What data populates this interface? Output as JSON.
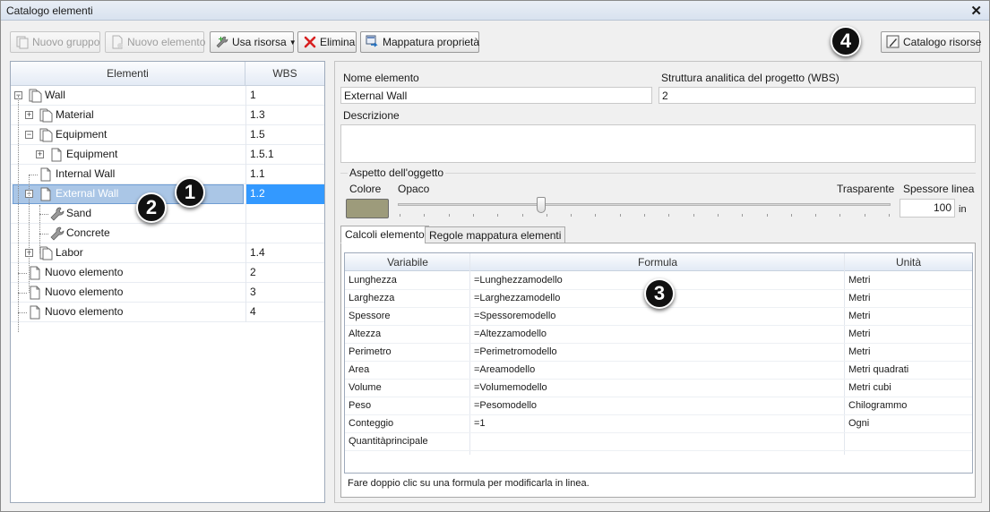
{
  "window": {
    "title": "Catalogo elementi"
  },
  "toolbar": {
    "new_group": "Nuovo gruppo",
    "new_element": "Nuovo elemento",
    "use_resource": "Usa risorsa",
    "delete": "Elimina",
    "property_mapping": "Mappatura proprietà",
    "resource_catalog": "Catalogo risorse"
  },
  "callouts": [
    "1",
    "2",
    "3",
    "4"
  ],
  "tree": {
    "col_elements": "Elementi",
    "col_wbs": "WBS",
    "rows": [
      {
        "name": "Wall",
        "wbs": "1"
      },
      {
        "name": "Material",
        "wbs": "1.3"
      },
      {
        "name": "Equipment",
        "wbs": "1.5"
      },
      {
        "name": "Equipment",
        "wbs": "1.5.1"
      },
      {
        "name": "Internal Wall",
        "wbs": "1.1"
      },
      {
        "name": "External Wall",
        "wbs": "1.2"
      },
      {
        "name": "Sand",
        "wbs": ""
      },
      {
        "name": "Concrete",
        "wbs": ""
      },
      {
        "name": "Labor",
        "wbs": "1.4"
      },
      {
        "name": "Nuovo elemento",
        "wbs": "2"
      },
      {
        "name": "Nuovo elemento",
        "wbs": "3"
      },
      {
        "name": "Nuovo elemento",
        "wbs": "4"
      }
    ]
  },
  "details": {
    "name_label": "Nome elemento",
    "name_value": "External Wall",
    "wbs_label": "Struttura analitica del progetto (WBS)",
    "wbs_value": "2",
    "description_label": "Descrizione",
    "description_value": "",
    "appearance": {
      "group_label": "Aspetto dell'oggetto",
      "color_label": "Colore",
      "opaque_label": "Opaco",
      "transparent_label": "Trasparente",
      "line_thickness_label": "Spessore linea",
      "line_thickness_value": "100",
      "line_thickness_unit": "in",
      "transparency_fraction": 0.29,
      "color": "#9d9b7b"
    },
    "tabs": [
      "Calcoli elemento",
      "Regole mappatura elementi"
    ],
    "grid": {
      "headers": [
        "Variabile",
        "Formula",
        "Unità"
      ],
      "rows": [
        {
          "variable": "Lunghezza",
          "formula": "=Lunghezzamodello",
          "unit": "Metri"
        },
        {
          "variable": "Larghezza",
          "formula": "=Larghezzamodello",
          "unit": "Metri"
        },
        {
          "variable": "Spessore",
          "formula": "=Spessoremodello",
          "unit": "Metri"
        },
        {
          "variable": "Altezza",
          "formula": "=Altezzamodello",
          "unit": "Metri"
        },
        {
          "variable": "Perimetro",
          "formula": "=Perimetromodello",
          "unit": "Metri"
        },
        {
          "variable": "Area",
          "formula": "=Areamodello",
          "unit": "Metri quadrati"
        },
        {
          "variable": "Volume",
          "formula": "=Volumemodello",
          "unit": "Metri cubi"
        },
        {
          "variable": "Peso",
          "formula": "=Pesomodello",
          "unit": "Chilogrammo"
        },
        {
          "variable": "Conteggio",
          "formula": "=1",
          "unit": "Ogni"
        },
        {
          "variable": "Quantitàprincipale",
          "formula": "",
          "unit": ""
        }
      ]
    },
    "hint": "Fare doppio clic su una formula per modificarla in linea."
  }
}
